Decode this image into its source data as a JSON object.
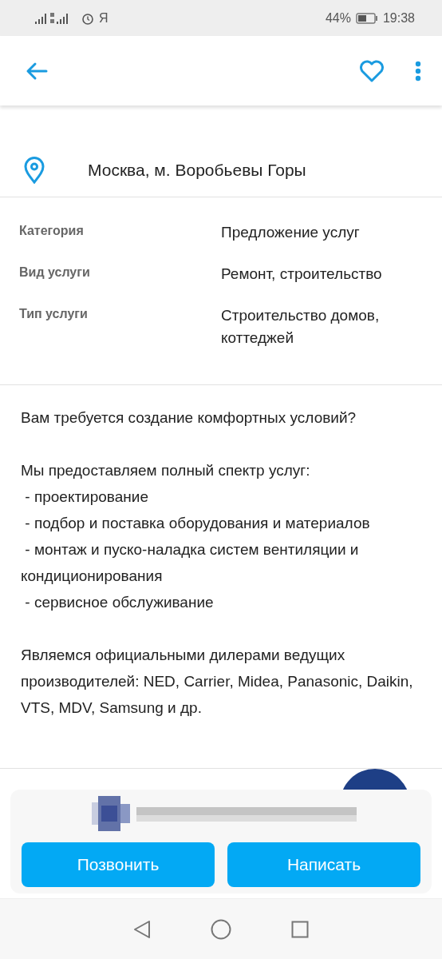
{
  "status_bar": {
    "carrier_label": "Я",
    "battery_text": "44%",
    "time": "19:38"
  },
  "location": {
    "text": "Москва, м. Воробьевы Горы"
  },
  "params": [
    {
      "label": "Категория",
      "value": "Предложение услуг"
    },
    {
      "label": "Вид услуги",
      "value": "Ремонт, строительство"
    },
    {
      "label": "Тип услуги",
      "value": "Строительство домов, коттеджей"
    }
  ],
  "description": [
    [
      "Вам требуется создание комфортных условий?"
    ],
    [
      "Мы предоставляем полный спектр услуг:",
      " - проектирование",
      " - подбор и поставка оборудования и материалов",
      " - монтаж и пуско-наладка систем вентиляции и кондиционирования",
      " - сервисное обслуживание"
    ],
    [
      "Являемся официальными дилерами ведущих производителей: NED, Carrier, Midea, Panasonic, Daikin, VTS, MDV, Samsung и др."
    ]
  ],
  "buttons": [
    {
      "label": "Позвонить"
    },
    {
      "label": "Написать"
    }
  ]
}
